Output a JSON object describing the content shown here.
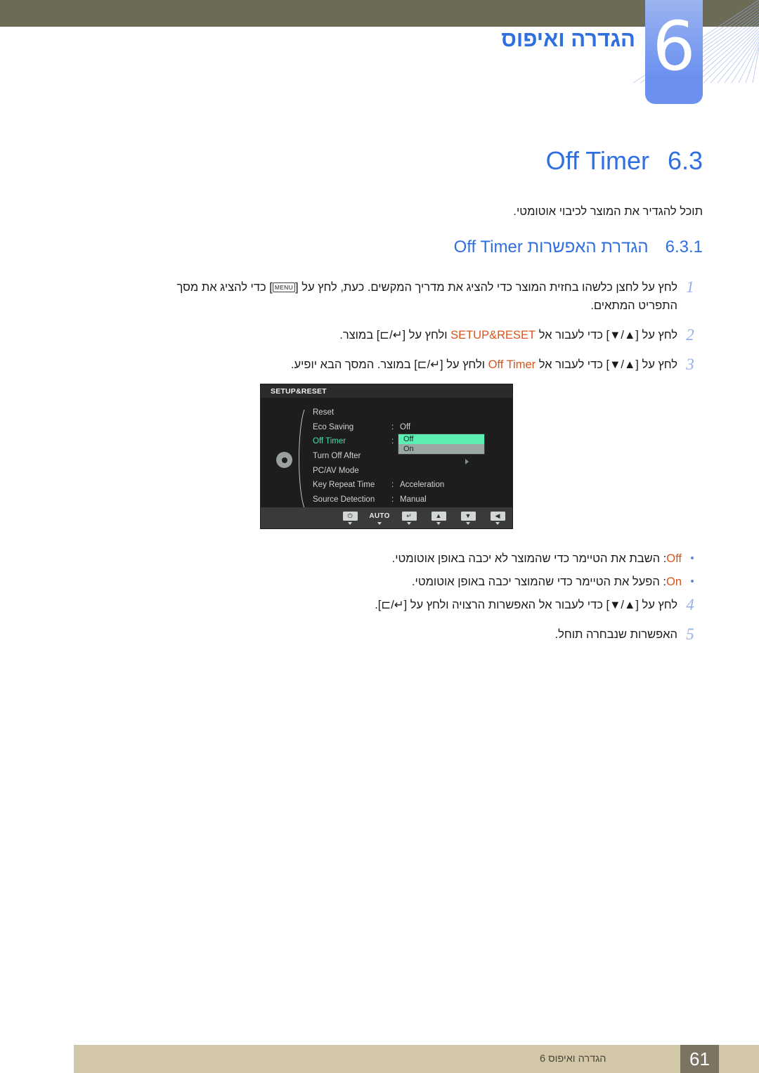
{
  "header": {
    "chapter_number": "6",
    "chapter_title": "הגדרה ואיפוס"
  },
  "section": {
    "number": "6.3",
    "title": "Off Timer",
    "intro": "תוכל להגדיר את המוצר לכיבוי אוטומטי.",
    "sub_number": "6.3.1",
    "sub_title_he": "הגדרת האפשרות",
    "sub_title_en": "Off Timer"
  },
  "steps": [
    {
      "num": "1",
      "line1_a": "לחץ על לחצן כלשהו בחזית המוצר כדי להציג את מדריך המקשים. כעת, לחץ על [",
      "key": "MENU",
      "line1_b": "] כדי להציג את מסך",
      "line2": "התפריט המתאים."
    },
    {
      "num": "2",
      "pre": "לחץ על [▲/▼] כדי לעבור אל ",
      "hl": "SETUP&RESET",
      "post": " ולחץ על [↵/⊐] במוצר."
    },
    {
      "num": "3",
      "pre": "לחץ על [▲/▼] כדי לעבור אל ",
      "hl": "Off Timer",
      "post": " ולחץ על [↵/⊐] במוצר. המסך הבא יופיע."
    }
  ],
  "osd": {
    "title": "SETUP&RESET",
    "rows": [
      {
        "label": "Reset",
        "colon": "",
        "value": ""
      },
      {
        "label": "Eco Saving",
        "colon": ":",
        "value": "Off"
      },
      {
        "label": "Off Timer",
        "colon": ":",
        "value": ""
      },
      {
        "label": "Turn Off After",
        "colon": "",
        "value": ""
      },
      {
        "label": "PC/AV Mode",
        "colon": "",
        "value": ""
      },
      {
        "label": "Key Repeat Time",
        "colon": ":",
        "value": "Acceleration"
      },
      {
        "label": "Source Detection",
        "colon": ":",
        "value": "Manual"
      }
    ],
    "dropdown": {
      "option_highlighted": "Off",
      "option_second": "On"
    },
    "buttons": [
      {
        "glyph": "◀",
        "type": "glyph"
      },
      {
        "glyph": "▼",
        "type": "glyph"
      },
      {
        "glyph": "▲",
        "type": "glyph"
      },
      {
        "glyph": "↵",
        "type": "glyph"
      },
      {
        "glyph": "AUTO",
        "type": "text"
      },
      {
        "glyph": "⏻",
        "type": "glyph"
      }
    ]
  },
  "bullets": [
    {
      "dot": "•",
      "hl": "Off",
      "text": ": השבת את הטיימר כדי שהמוצר לא יכבה באופן אוטומטי."
    },
    {
      "dot": "•",
      "hl": "On",
      "text": ": הפעל את הטיימר כדי שהמוצר יכבה באופן אוטומטי."
    }
  ],
  "steps2": [
    {
      "num": "4",
      "text": "לחץ על [▲/▼] כדי לעבור אל האפשרות הרצויה ולחץ על [↵/⊐]."
    },
    {
      "num": "5",
      "text": "האפשרות שנבחרה תוחל."
    }
  ],
  "footer": {
    "page": "61",
    "text": "הגדרה ואיפוס 6"
  },
  "colors": {
    "header_bar": "#6c6b56",
    "accent_blue": "#2f6fe0",
    "step_num": "#93b0ea",
    "highlight_orange": "#d8541a",
    "osd_bg": "#1d1d1d",
    "osd_selected": "#4de0a6",
    "dropdown_highlight": "#5bf0b2",
    "footer_bar": "#d2c7a7",
    "footer_page_box": "#7d7362"
  }
}
